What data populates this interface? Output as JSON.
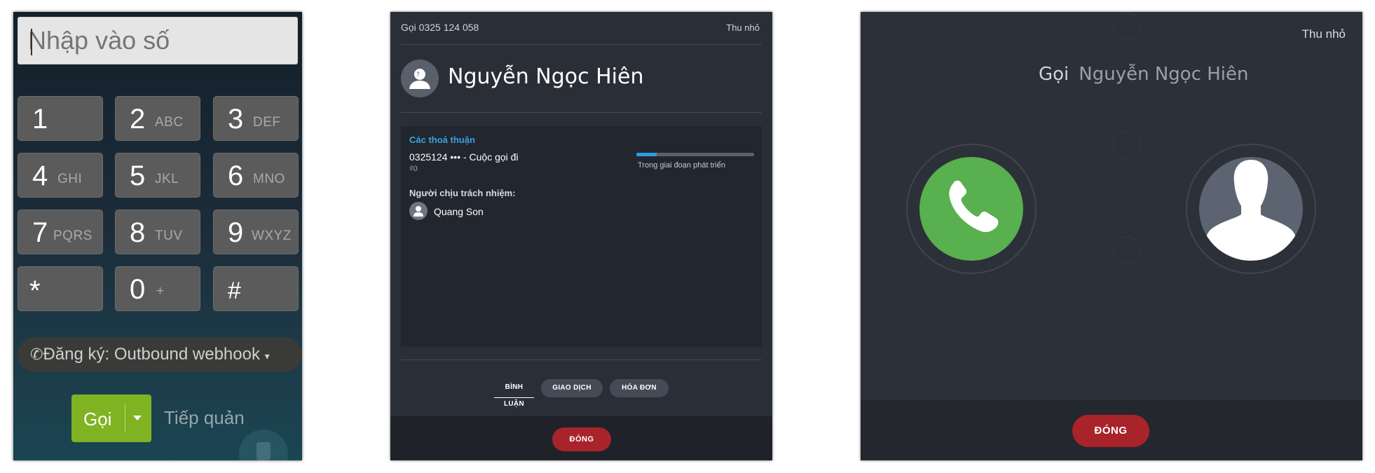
{
  "dialer": {
    "input_placeholder": "Nhập vào số",
    "keys": [
      {
        "digit": "1",
        "letters": ""
      },
      {
        "digit": "2",
        "letters": "ABC"
      },
      {
        "digit": "3",
        "letters": "DEF"
      },
      {
        "digit": "4",
        "letters": "GHI"
      },
      {
        "digit": "5",
        "letters": "JKL"
      },
      {
        "digit": "6",
        "letters": "MNO"
      },
      {
        "digit": "7",
        "letters": "PQRS"
      },
      {
        "digit": "8",
        "letters": "TUV"
      },
      {
        "digit": "9",
        "letters": "WXYZ"
      },
      {
        "digit": "*",
        "letters": ""
      },
      {
        "digit": "0",
        "letters": "+"
      },
      {
        "digit": "#",
        "letters": ""
      }
    ],
    "register_label": "Đăng ký: Outbound webhook",
    "call_label": "Gọi",
    "takeover_label": "Tiếp quản"
  },
  "call_detail": {
    "header": "Gọi 0325 124 058",
    "minimize": "Thu nhỏ",
    "contact_name": "Nguyễn Ngọc Hiên",
    "deals_title": "Các thoả thuận",
    "deal_name": "0325124 ••• - Cuộc gọi đi",
    "deal_amount": "₫0",
    "deal_progress": 0.17,
    "deal_stage": "Trong giai đoạn phát triển",
    "responsible_label": "Người chịu trách nhiệm:",
    "responsible_name": "Quang Son",
    "tabs": [
      "BÌNH LUẬN",
      "GIAO DỊCH",
      "HÓA ĐƠN"
    ],
    "close_label": "ĐÓNG"
  },
  "calling": {
    "minimize": "Thu nhỏ",
    "call_word": "Gọi",
    "contact_name": "Nguyễn Ngọc Hiên",
    "close_label": "ĐÓNG"
  },
  "colors": {
    "call_green": "#58b04f",
    "dial_call_green": "#7fb321",
    "close_red": "#a8242a",
    "accent_blue": "#3aa3e2"
  }
}
